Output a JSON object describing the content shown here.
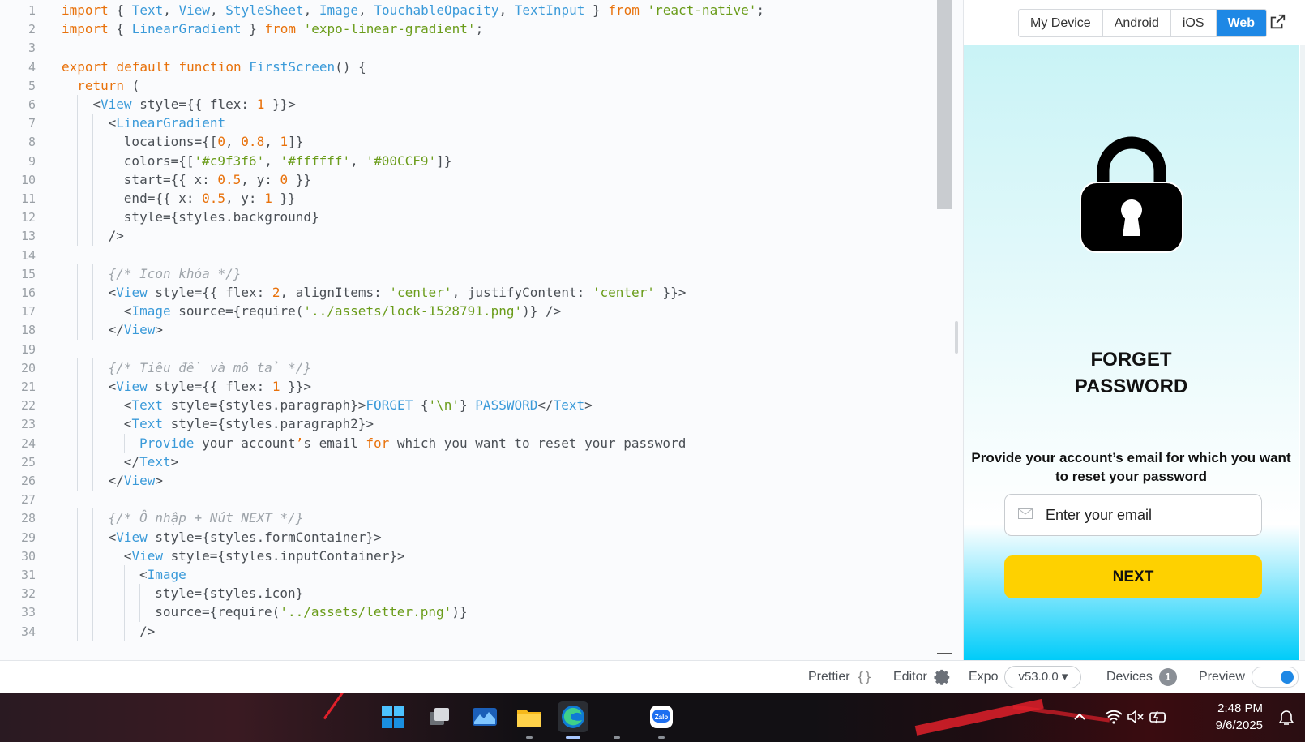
{
  "editor": {
    "lines": [
      {
        "n": "1",
        "i": 0,
        "seg": [
          [
            "k",
            "import"
          ],
          [
            "p",
            " { "
          ],
          [
            "t",
            "Text"
          ],
          [
            "p",
            ", "
          ],
          [
            "t",
            "View"
          ],
          [
            "p",
            ", "
          ],
          [
            "t",
            "StyleSheet"
          ],
          [
            "p",
            ", "
          ],
          [
            "t",
            "Image"
          ],
          [
            "p",
            ", "
          ],
          [
            "t",
            "TouchableOpacity"
          ],
          [
            "p",
            ", "
          ],
          [
            "t",
            "TextInput"
          ],
          [
            "p",
            " } "
          ],
          [
            "k",
            "from"
          ],
          [
            "p",
            " "
          ],
          [
            "s",
            "'react-native'"
          ],
          [
            "p",
            ";"
          ]
        ]
      },
      {
        "n": "2",
        "i": 0,
        "seg": [
          [
            "k",
            "import"
          ],
          [
            "p",
            " { "
          ],
          [
            "t",
            "LinearGradient"
          ],
          [
            "p",
            " } "
          ],
          [
            "k",
            "from"
          ],
          [
            "p",
            " "
          ],
          [
            "s",
            "'expo-linear-gradient'"
          ],
          [
            "p",
            ";"
          ]
        ]
      },
      {
        "n": "3",
        "i": 0,
        "seg": []
      },
      {
        "n": "4",
        "i": 0,
        "seg": [
          [
            "k",
            "export"
          ],
          [
            "p",
            " "
          ],
          [
            "k",
            "default"
          ],
          [
            "p",
            " "
          ],
          [
            "k",
            "function"
          ],
          [
            "p",
            " "
          ],
          [
            "t",
            "FirstScreen"
          ],
          [
            "p",
            "() {"
          ]
        ]
      },
      {
        "n": "5",
        "i": 1,
        "seg": [
          [
            "k",
            "return"
          ],
          [
            "p",
            " ("
          ]
        ]
      },
      {
        "n": "6",
        "i": 2,
        "seg": [
          [
            "p",
            "<"
          ],
          [
            "t",
            "View"
          ],
          [
            "p",
            " style={{ flex: "
          ],
          [
            "n",
            "1"
          ],
          [
            "p",
            " }}>"
          ]
        ]
      },
      {
        "n": "7",
        "i": 3,
        "seg": [
          [
            "p",
            "<"
          ],
          [
            "t",
            "LinearGradient"
          ]
        ]
      },
      {
        "n": "8",
        "i": 4,
        "seg": [
          [
            "p",
            "locations={["
          ],
          [
            "n",
            "0"
          ],
          [
            "p",
            ", "
          ],
          [
            "n",
            "0.8"
          ],
          [
            "p",
            ", "
          ],
          [
            "n",
            "1"
          ],
          [
            "p",
            "]}"
          ]
        ]
      },
      {
        "n": "9",
        "i": 4,
        "seg": [
          [
            "p",
            "colors={["
          ],
          [
            "s",
            "'#c9f3f6'"
          ],
          [
            "p",
            ", "
          ],
          [
            "s",
            "'#ffffff'"
          ],
          [
            "p",
            ", "
          ],
          [
            "s",
            "'#00CCF9'"
          ],
          [
            "p",
            "]}"
          ]
        ]
      },
      {
        "n": "10",
        "i": 4,
        "seg": [
          [
            "p",
            "start={{ x: "
          ],
          [
            "n",
            "0.5"
          ],
          [
            "p",
            ", y: "
          ],
          [
            "n",
            "0"
          ],
          [
            "p",
            " }}"
          ]
        ]
      },
      {
        "n": "11",
        "i": 4,
        "seg": [
          [
            "p",
            "end={{ x: "
          ],
          [
            "n",
            "0.5"
          ],
          [
            "p",
            ", y: "
          ],
          [
            "n",
            "1"
          ],
          [
            "p",
            " }}"
          ]
        ]
      },
      {
        "n": "12",
        "i": 4,
        "seg": [
          [
            "p",
            "style={styles.background}"
          ]
        ]
      },
      {
        "n": "13",
        "i": 3,
        "seg": [
          [
            "p",
            "/>"
          ]
        ]
      },
      {
        "n": "14",
        "i": 0,
        "seg": []
      },
      {
        "n": "15",
        "i": 3,
        "seg": [
          [
            "c",
            "{/* Icon khóa */}"
          ]
        ]
      },
      {
        "n": "16",
        "i": 3,
        "seg": [
          [
            "p",
            "<"
          ],
          [
            "t",
            "View"
          ],
          [
            "p",
            " style={{ flex: "
          ],
          [
            "n",
            "2"
          ],
          [
            "p",
            ", alignItems: "
          ],
          [
            "s",
            "'center'"
          ],
          [
            "p",
            ", justifyContent: "
          ],
          [
            "s",
            "'center'"
          ],
          [
            "p",
            " }}>"
          ]
        ]
      },
      {
        "n": "17",
        "i": 4,
        "seg": [
          [
            "p",
            "<"
          ],
          [
            "t",
            "Image"
          ],
          [
            "p",
            " source={require("
          ],
          [
            "s",
            "'../assets/lock-1528791.png'"
          ],
          [
            "p",
            ")} />"
          ]
        ]
      },
      {
        "n": "18",
        "i": 3,
        "seg": [
          [
            "p",
            "</"
          ],
          [
            "t",
            "View"
          ],
          [
            "p",
            ">"
          ]
        ]
      },
      {
        "n": "19",
        "i": 0,
        "seg": []
      },
      {
        "n": "20",
        "i": 3,
        "seg": [
          [
            "c",
            "{/* Tiêu đề và mô tả */}"
          ]
        ]
      },
      {
        "n": "21",
        "i": 3,
        "seg": [
          [
            "p",
            "<"
          ],
          [
            "t",
            "View"
          ],
          [
            "p",
            " style={{ flex: "
          ],
          [
            "n",
            "1"
          ],
          [
            "p",
            " }}>"
          ]
        ]
      },
      {
        "n": "22",
        "i": 4,
        "seg": [
          [
            "p",
            "<"
          ],
          [
            "t",
            "Text"
          ],
          [
            "p",
            " style={styles.paragraph}>"
          ],
          [
            "t",
            "FORGET "
          ],
          [
            "p",
            "{"
          ],
          [
            "s",
            "'\\n'"
          ],
          [
            "p",
            "} "
          ],
          [
            "t",
            "PASSWORD"
          ],
          [
            "p",
            "</"
          ],
          [
            "t",
            "Text"
          ],
          [
            "p",
            ">"
          ]
        ]
      },
      {
        "n": "23",
        "i": 4,
        "seg": [
          [
            "p",
            "<"
          ],
          [
            "t",
            "Text"
          ],
          [
            "p",
            " style={styles.paragraph2}>"
          ]
        ]
      },
      {
        "n": "24",
        "i": 5,
        "seg": [
          [
            "t",
            "Provide"
          ],
          [
            "p",
            " your account"
          ],
          [
            "k",
            "’"
          ],
          [
            "p",
            "s email "
          ],
          [
            "k",
            "for"
          ],
          [
            "p",
            " which you want to reset your password"
          ]
        ]
      },
      {
        "n": "25",
        "i": 4,
        "seg": [
          [
            "p",
            "</"
          ],
          [
            "t",
            "Text"
          ],
          [
            "p",
            ">"
          ]
        ]
      },
      {
        "n": "26",
        "i": 3,
        "seg": [
          [
            "p",
            "</"
          ],
          [
            "t",
            "View"
          ],
          [
            "p",
            ">"
          ]
        ]
      },
      {
        "n": "27",
        "i": 0,
        "seg": []
      },
      {
        "n": "28",
        "i": 3,
        "seg": [
          [
            "c",
            "{/* Ô nhập + Nút NEXT */}"
          ]
        ]
      },
      {
        "n": "29",
        "i": 3,
        "seg": [
          [
            "p",
            "<"
          ],
          [
            "t",
            "View"
          ],
          [
            "p",
            " style={styles.formContainer}>"
          ]
        ]
      },
      {
        "n": "30",
        "i": 4,
        "seg": [
          [
            "p",
            "<"
          ],
          [
            "t",
            "View"
          ],
          [
            "p",
            " style={styles.inputContainer}>"
          ]
        ]
      },
      {
        "n": "31",
        "i": 5,
        "seg": [
          [
            "p",
            "<"
          ],
          [
            "t",
            "Image"
          ]
        ]
      },
      {
        "n": "32",
        "i": 6,
        "seg": [
          [
            "p",
            "style={styles.icon}"
          ]
        ]
      },
      {
        "n": "33",
        "i": 6,
        "seg": [
          [
            "p",
            "source={require("
          ],
          [
            "s",
            "'../assets/letter.png'"
          ],
          [
            "p",
            ")}"
          ]
        ]
      },
      {
        "n": "34",
        "i": 5,
        "seg": [
          [
            "p",
            "/>"
          ]
        ]
      }
    ]
  },
  "preview": {
    "tabs": [
      {
        "label": "My Device",
        "active": false
      },
      {
        "label": "Android",
        "active": false
      },
      {
        "label": "iOS",
        "active": false
      },
      {
        "label": "Web",
        "active": true
      }
    ],
    "app": {
      "title": "FORGET\nPASSWORD",
      "description": "Provide your account’s email for which you want to reset your password",
      "email_placeholder": "Enter your email",
      "next_label": "NEXT",
      "gradient_colors": [
        "#c9f3f6",
        "#ffffff",
        "#00CCF9"
      ]
    }
  },
  "statusbar": {
    "prettier": "Prettier",
    "prettier_icon": "{}",
    "editor": "Editor",
    "expo": "Expo",
    "expo_version": "v53.0.0 ▾",
    "devices": "Devices",
    "devices_count": "1",
    "preview": "Preview",
    "preview_on": true
  },
  "taskbar": {
    "apps": [
      "windows-start",
      "task-view",
      "stocks-widget",
      "file-explorer",
      "edge",
      "store",
      "zalo"
    ],
    "time": "2:48 PM",
    "date": "9/6/2025"
  },
  "colors": {
    "accent": "#1e88e5",
    "next_button": "#fed100"
  }
}
